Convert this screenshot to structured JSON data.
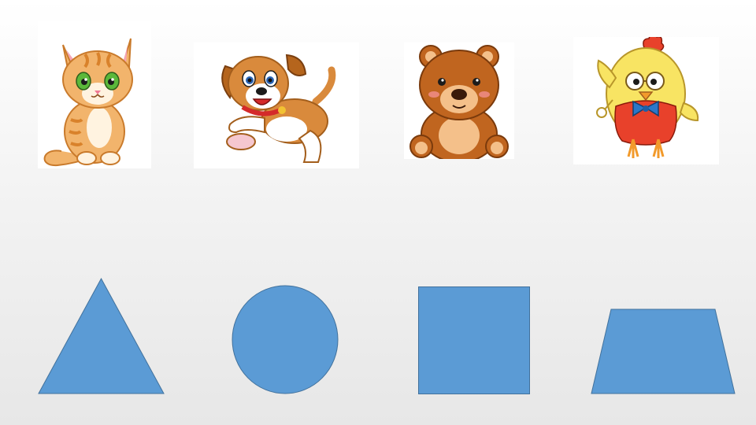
{
  "slide": {
    "background_top": "#ffffff",
    "background_bottom": "#e7e7e7"
  },
  "animals": [
    {
      "name": "cat",
      "icon": "cat-illustration",
      "colors": {
        "fur": "#f2b46c",
        "stripes": "#d9822b",
        "eyes": "#5bb83a"
      }
    },
    {
      "name": "dog",
      "icon": "dog-illustration",
      "colors": {
        "fur": "#d98a3c",
        "belly": "#ffffff",
        "collar": "#d42a2a"
      }
    },
    {
      "name": "bear",
      "icon": "bear-illustration",
      "colors": {
        "fur": "#c0651f",
        "muzzle": "#f4c08a",
        "nose": "#3a1a0a"
      }
    },
    {
      "name": "chick",
      "icon": "chick-illustration",
      "colors": {
        "body": "#f8e463",
        "vest": "#e8412b",
        "bowtie": "#2a77c9",
        "comb": "#e8412b"
      }
    }
  ],
  "shapes": {
    "fill": "#5b9bd5",
    "stroke": "#41719c",
    "items": [
      {
        "name": "triangle"
      },
      {
        "name": "circle"
      },
      {
        "name": "square"
      },
      {
        "name": "trapezoid"
      }
    ]
  }
}
